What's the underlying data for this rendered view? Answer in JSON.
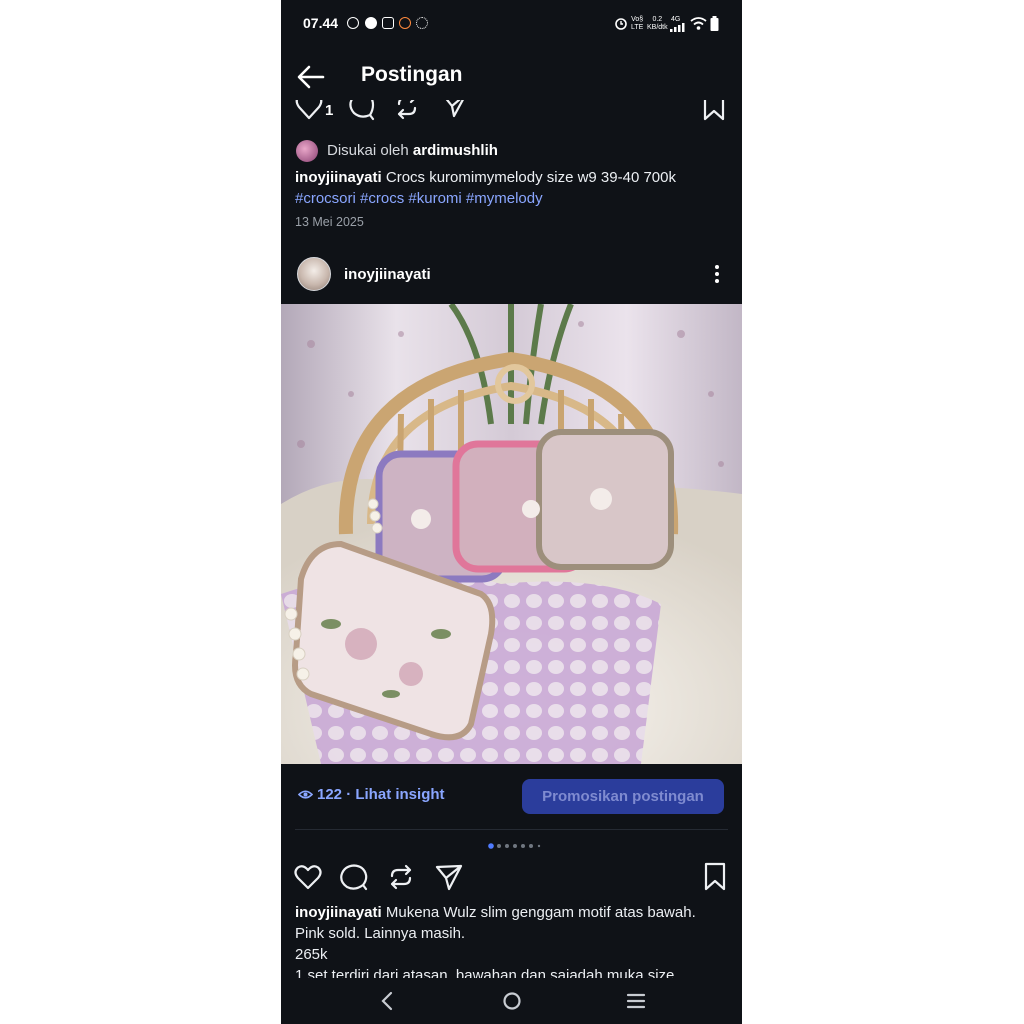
{
  "status_bar": {
    "time": "07.44",
    "network_labels": [
      "Vo§",
      "LTE",
      "0.2",
      "KB/dtk",
      "4G"
    ]
  },
  "header": {
    "title": "Postingan"
  },
  "post1": {
    "like_count": "1",
    "liked_by_prefix": "Disukai oleh",
    "liked_by_user": "ardimushlih",
    "username": "inoyjiinayati",
    "caption": "Crocs kuromimymelody size w9 39-40 700k",
    "hashtags": [
      "#crocsori",
      "#crocs",
      "#kuromi",
      "#mymelody"
    ],
    "date": "13 Mei 2025"
  },
  "post2": {
    "username": "inoyjiinayati",
    "image_icon": "photo-of-floral-pouches-in-rattan-basket",
    "insight_label": "122 · Lihat insight",
    "promote_label": "Promosikan postingan",
    "carousel_count": 7,
    "carousel_active": 0,
    "caption_lines": [
      "Mukena Wulz slim genggam motif atas bawah.",
      "Pink sold. Lainnya masih.",
      "265k",
      "1 set terdiri dari atasan, bawahan dan sajadah muka size"
    ]
  },
  "colors": {
    "background": "#0f1217",
    "accent_link": "#8aa6ff",
    "promote_button": "#2b3d9c"
  },
  "icons": [
    "arrow-left-icon",
    "heart-icon",
    "comment-icon",
    "repost-icon",
    "send-icon",
    "bookmark-icon",
    "more-vertical-icon",
    "eye-icon",
    "nav-back-icon",
    "nav-home-icon",
    "nav-menu-icon"
  ]
}
